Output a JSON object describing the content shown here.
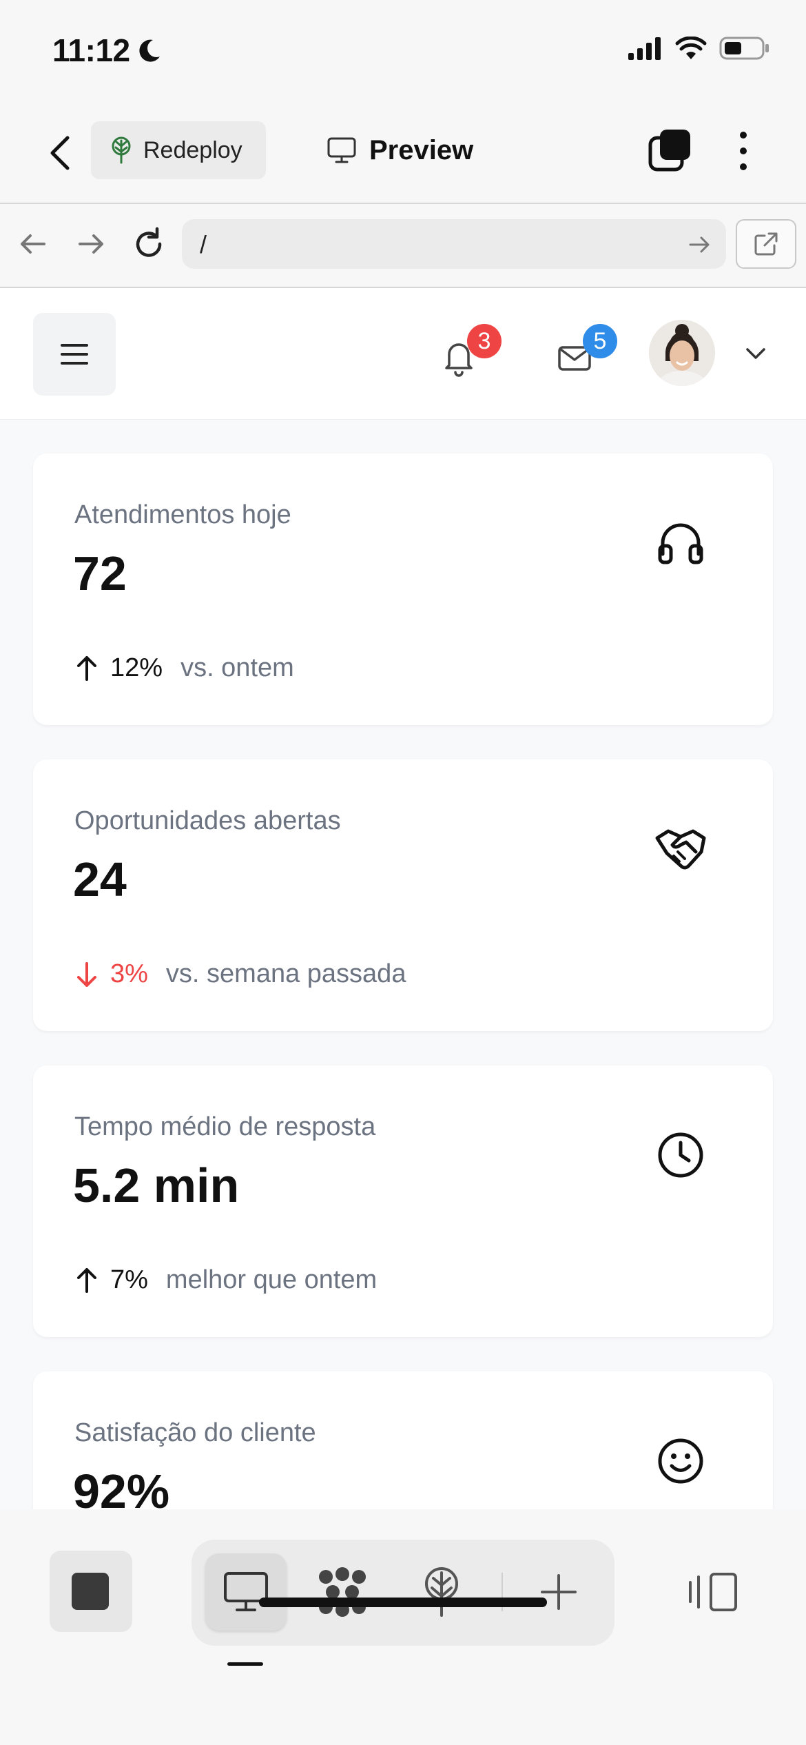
{
  "status_bar": {
    "time": "11:12"
  },
  "app_header": {
    "redeploy_label": "Redeploy",
    "preview_label": "Preview"
  },
  "browser": {
    "url": "/"
  },
  "site_header": {
    "notifications_count": "3",
    "messages_count": "5"
  },
  "cards": [
    {
      "label": "Atendimentos hoje",
      "value": "72",
      "delta": "12%",
      "caption": "vs. ontem",
      "trend": "up",
      "icon": "headphones-icon"
    },
    {
      "label": "Oportunidades abertas",
      "value": "24",
      "delta": "3%",
      "caption": "vs. semana passada",
      "trend": "down",
      "icon": "handshake-icon"
    },
    {
      "label": "Tempo médio de resposta",
      "value": "5.2 min",
      "delta": "7%",
      "caption": "melhor que ontem",
      "trend": "up",
      "icon": "clock-icon"
    },
    {
      "label": "Satisfação do cliente",
      "value": "92%",
      "icon": "smiley-icon"
    }
  ],
  "colors": {
    "badge_red": "#ef4444",
    "badge_blue": "#2f8ce8",
    "trend_down": "#ef4444",
    "muted_text": "#6b7280",
    "brand_green": "#2f7a3c"
  }
}
